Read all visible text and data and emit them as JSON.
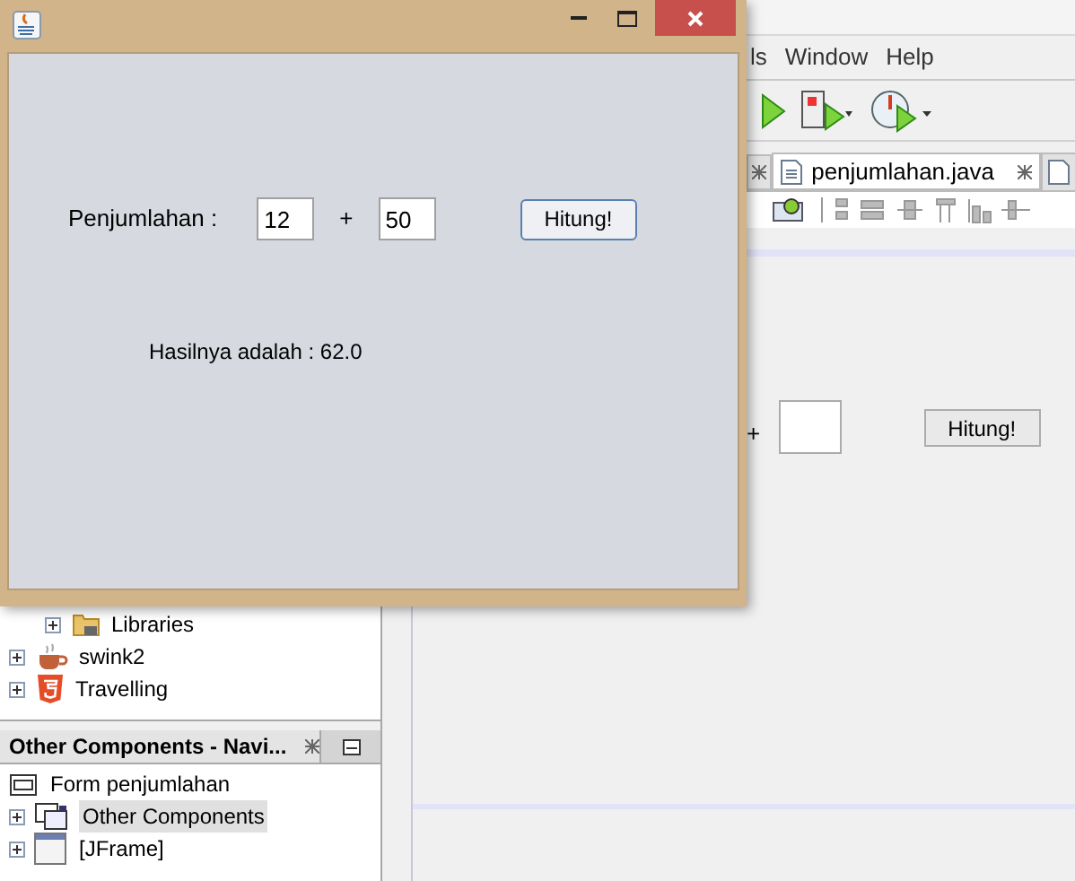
{
  "ide": {
    "menu": [
      "ls",
      "Window",
      "Help"
    ],
    "editor_tabs": [
      {
        "label": "penjumlahan.java",
        "selected": true
      }
    ],
    "design_preview": {
      "operator": "+",
      "button": "Hitung!"
    },
    "project_tree": {
      "items": [
        {
          "label": "Libraries",
          "kind": "folder",
          "expanded": false
        },
        {
          "label": "swink2",
          "kind": "coffee",
          "expanded": false
        },
        {
          "label": "Travelling",
          "kind": "html",
          "expanded": false
        }
      ]
    },
    "navigator": {
      "title": "Other Components - Navi...",
      "items": [
        {
          "label": "Form penjumlahan",
          "kind": "form",
          "selected": false
        },
        {
          "label": "Other Components",
          "kind": "components",
          "selected": true,
          "expanded": false
        },
        {
          "label": "[JFrame]",
          "kind": "frame",
          "selected": false,
          "expanded": false
        }
      ]
    }
  },
  "app_window": {
    "label": "Penjumlahan :",
    "first_value": "12",
    "operator": "+",
    "second_value": "50",
    "button": "Hitung!",
    "result": "Hasilnya adalah : 62.0"
  }
}
